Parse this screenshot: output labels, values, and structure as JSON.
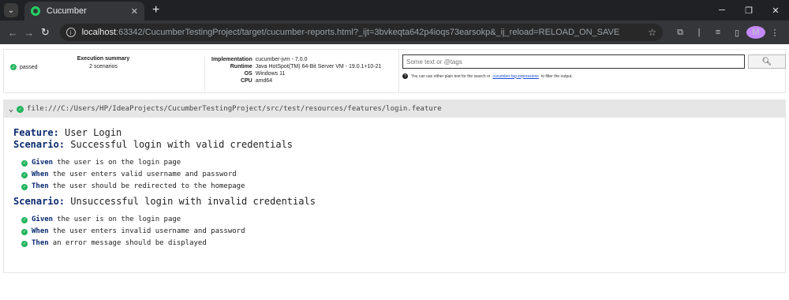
{
  "browser": {
    "tab_title": "Cucumber",
    "url_host": "localhost",
    "url_rest": ":63342/CucumberTestingProject/target/cucumber-reports.html?_ijt=3bvkeqta642p4ioqs73earsokp&_ij_reload=RELOAD_ON_SAVE",
    "avatar_letter": "M"
  },
  "summary": {
    "status": "passed",
    "title": "Execution summary",
    "scenarios": "2 scenarios"
  },
  "environment": {
    "implementation_label": "Implementation",
    "implementation_value": "cucumber-jvm - 7.0.0",
    "runtime_label": "Runtime",
    "runtime_value": "Java HotSpot(TM) 64-Bit Server VM - 19.0.1+10-21",
    "os_label": "OS",
    "os_value": "Windows 11",
    "cpu_label": "CPU",
    "cpu_value": "amd64"
  },
  "search": {
    "placeholder": "Some text or @tags",
    "help_before": "You can use either plain text for the search or",
    "help_link": "cucumber tag expressions",
    "help_after": "to filter the output."
  },
  "feature": {
    "path": "file:///C:/Users/HP/IdeaProjects/CucumberTestingProject/src/test/resources/features/login.feature",
    "keyword": "Feature:",
    "name": "User Login",
    "scenarios": [
      {
        "keyword": "Scenario:",
        "name": "Successful login with valid credentials",
        "steps": [
          {
            "keyword": "Given",
            "text": "the user is on the login page"
          },
          {
            "keyword": "When",
            "text": "the user enters valid username and password"
          },
          {
            "keyword": "Then",
            "text": "the user should be redirected to the homepage"
          }
        ]
      },
      {
        "keyword": "Scenario:",
        "name": "Unsuccessful login with invalid credentials",
        "steps": [
          {
            "keyword": "Given",
            "text": "the user is on the login page"
          },
          {
            "keyword": "When",
            "text": "the user enters invalid username and password"
          },
          {
            "keyword": "Then",
            "text": "an error message should be displayed"
          }
        ]
      }
    ]
  },
  "colors": {
    "passed": "#23b55d",
    "keyword": "#0a2a6e",
    "feature_bar": "#e6e6e6"
  }
}
